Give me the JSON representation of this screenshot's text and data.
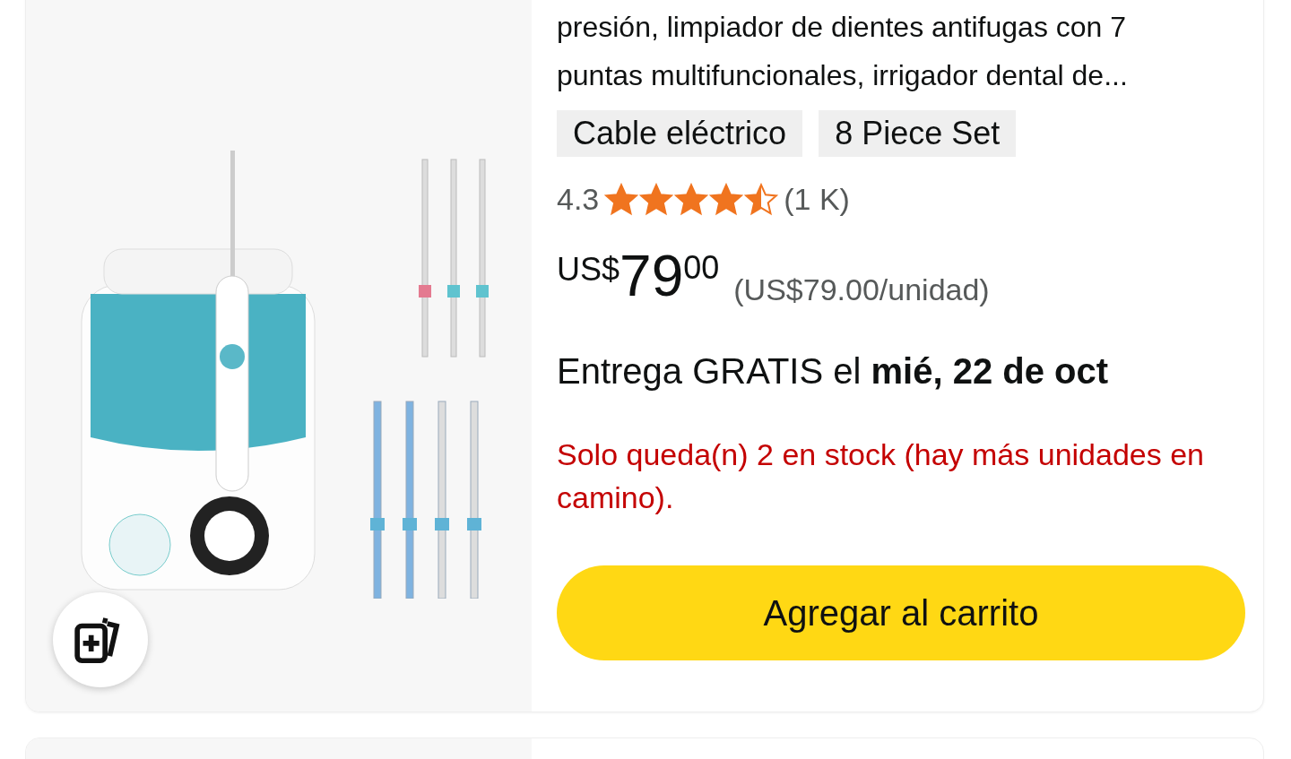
{
  "product": {
    "title_lines": [
      "presión, limpiador de dientes antifugas con 7",
      "puntas multifuncionales, irrigador dental de..."
    ],
    "options": [
      {
        "label": "Cable eléctrico"
      },
      {
        "label": "8 Piece Set"
      }
    ],
    "rating": {
      "score": "4.3",
      "stars": 4.5,
      "count": "(1 K)"
    },
    "price": {
      "currency": "US$",
      "whole": "79",
      "fraction": "00",
      "unit_price": "(US$79.00/unidad)"
    },
    "delivery": "Entrega GRATIS el **mié, 22 de oct**",
    "stock": "Solo queda(n) 2 en stock (hay más unidades en camino).",
    "add_to_cart": "Agregar al carrito"
  }
}
